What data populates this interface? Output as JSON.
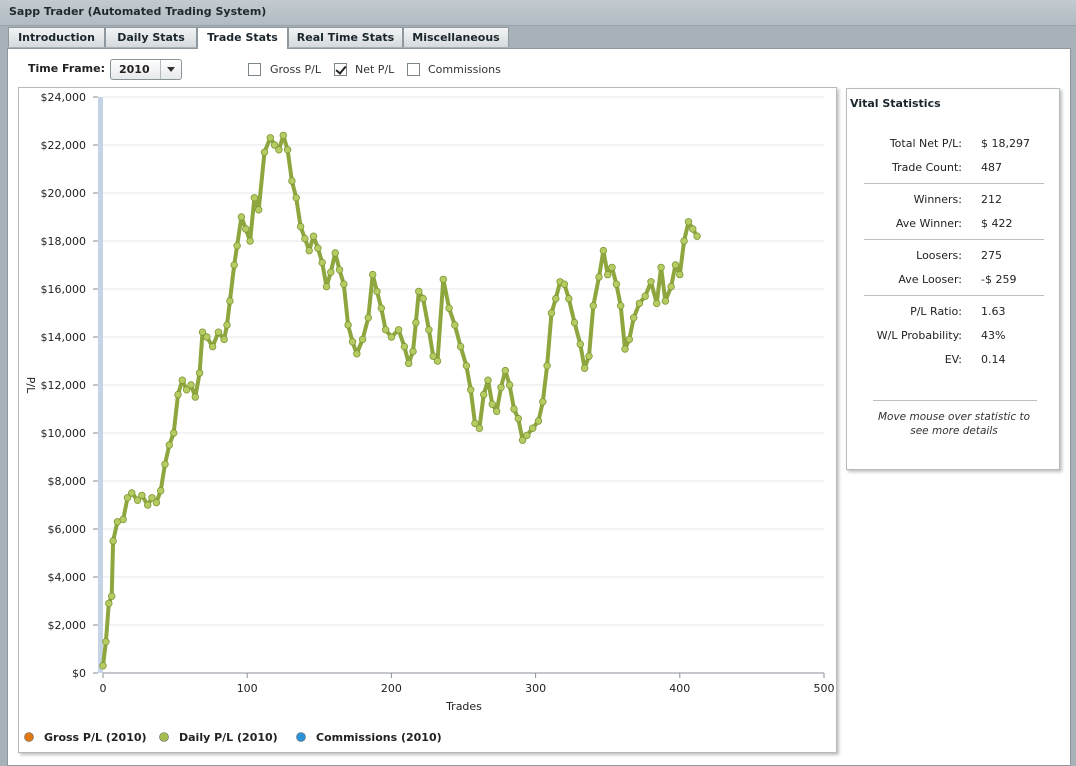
{
  "window": {
    "title": "Sapp Trader (Automated Trading System)"
  },
  "tabs": [
    {
      "label": "Introduction"
    },
    {
      "label": "Daily Stats"
    },
    {
      "label": "Trade Stats",
      "active": true
    },
    {
      "label": "Real Time Stats"
    },
    {
      "label": "Miscellaneous"
    }
  ],
  "controls": {
    "time_frame_label": "Time Frame:",
    "time_frame_value": "2010",
    "checkboxes": [
      {
        "label": "Gross P/L",
        "checked": false
      },
      {
        "label": "Net P/L",
        "checked": true
      },
      {
        "label": "Commissions",
        "checked": false
      }
    ]
  },
  "stats": {
    "title": "Vital Statistics",
    "rows": [
      {
        "label": "Total Net P/L:",
        "value": "$ 18,297"
      },
      {
        "label": "Trade Count:",
        "value": "487"
      },
      {
        "label": "Winners:",
        "value": "212"
      },
      {
        "label": "Ave Winner:",
        "value": "$ 422"
      },
      {
        "label": "Loosers:",
        "value": "275"
      },
      {
        "label": "Ave Looser:",
        "value": "-$ 259"
      },
      {
        "label": "P/L Ratio:",
        "value": "1.63"
      },
      {
        "label": "W/L Probability:",
        "value": "43%"
      },
      {
        "label": "EV:",
        "value": "0.14"
      }
    ],
    "hint_line1": "Move mouse over statistic to",
    "hint_line2": "see more details"
  },
  "chart_data": {
    "type": "line",
    "xlabel": "Trades",
    "ylabel": "P/L",
    "xlim": [
      0,
      500
    ],
    "ylim": [
      0,
      24000
    ],
    "x_ticks": [
      "0",
      "100",
      "200",
      "300",
      "400",
      "500"
    ],
    "y_ticks": [
      "$0",
      "$2,000",
      "$4,000",
      "$6,000",
      "$8,000",
      "$10,000",
      "$12,000",
      "$14,000",
      "$16,000",
      "$18,000",
      "$20,000",
      "$22,000",
      "$24,000"
    ],
    "grid": "horizontal",
    "legend_position": "bottom-left",
    "legend": [
      {
        "name": "Gross P/L (2010)",
        "color": "#e07a10"
      },
      {
        "name": "Daily P/L (2010)",
        "color": "#a6bd52"
      },
      {
        "name": "Commissions (2010)",
        "color": "#2b93d6"
      }
    ],
    "series": [
      {
        "name": "Daily P/L (2010)",
        "color": "#8ea63e",
        "marker_color": "#b5cc62",
        "points": [
          [
            0,
            300
          ],
          [
            2,
            1300
          ],
          [
            4,
            2900
          ],
          [
            6,
            3200
          ],
          [
            7,
            5500
          ],
          [
            10,
            6300
          ],
          [
            14,
            6400
          ],
          [
            17,
            7300
          ],
          [
            20,
            7500
          ],
          [
            24,
            7200
          ],
          [
            27,
            7400
          ],
          [
            31,
            7000
          ],
          [
            34,
            7300
          ],
          [
            37,
            7100
          ],
          [
            40,
            7600
          ],
          [
            43,
            8700
          ],
          [
            46,
            9500
          ],
          [
            49,
            10000
          ],
          [
            52,
            11600
          ],
          [
            55,
            12200
          ],
          [
            58,
            11800
          ],
          [
            61,
            12000
          ],
          [
            64,
            11500
          ],
          [
            67,
            12500
          ],
          [
            69,
            14200
          ],
          [
            72,
            14000
          ],
          [
            76,
            13600
          ],
          [
            80,
            14200
          ],
          [
            84,
            13900
          ],
          [
            86,
            14500
          ],
          [
            88,
            15500
          ],
          [
            91,
            17000
          ],
          [
            93,
            17800
          ],
          [
            96,
            19000
          ],
          [
            99,
            18500
          ],
          [
            102,
            18000
          ],
          [
            105,
            19800
          ],
          [
            108,
            19300
          ],
          [
            112,
            21700
          ],
          [
            116,
            22300
          ],
          [
            119,
            22000
          ],
          [
            122,
            21800
          ],
          [
            125,
            22400
          ],
          [
            128,
            21800
          ],
          [
            131,
            20500
          ],
          [
            134,
            19800
          ],
          [
            137,
            18600
          ],
          [
            140,
            18100
          ],
          [
            143,
            17600
          ],
          [
            146,
            18200
          ],
          [
            149,
            17700
          ],
          [
            152,
            17100
          ],
          [
            155,
            16100
          ],
          [
            158,
            16700
          ],
          [
            161,
            17500
          ],
          [
            164,
            16800
          ],
          [
            167,
            16200
          ],
          [
            170,
            14500
          ],
          [
            173,
            13800
          ],
          [
            176,
            13300
          ],
          [
            180,
            13900
          ],
          [
            184,
            14800
          ],
          [
            187,
            16600
          ],
          [
            190,
            15900
          ],
          [
            193,
            15200
          ],
          [
            196,
            14300
          ],
          [
            200,
            14000
          ],
          [
            205,
            14300
          ],
          [
            209,
            13600
          ],
          [
            212,
            12900
          ],
          [
            215,
            13400
          ],
          [
            217,
            14600
          ],
          [
            219,
            15900
          ],
          [
            222,
            15600
          ],
          [
            226,
            14300
          ],
          [
            229,
            13200
          ],
          [
            232,
            13000
          ],
          [
            236,
            16400
          ],
          [
            240,
            15200
          ],
          [
            244,
            14500
          ],
          [
            248,
            13600
          ],
          [
            252,
            12800
          ],
          [
            255,
            11800
          ],
          [
            258,
            10400
          ],
          [
            261,
            10200
          ],
          [
            264,
            11600
          ],
          [
            267,
            12200
          ],
          [
            270,
            11200
          ],
          [
            273,
            10900
          ],
          [
            276,
            11900
          ],
          [
            279,
            12600
          ],
          [
            282,
            12000
          ],
          [
            285,
            11000
          ],
          [
            288,
            10600
          ],
          [
            291,
            9700
          ],
          [
            294,
            9900
          ],
          [
            298,
            10200
          ],
          [
            302,
            10500
          ],
          [
            305,
            11300
          ],
          [
            308,
            12800
          ],
          [
            311,
            15000
          ],
          [
            314,
            15600
          ],
          [
            317,
            16300
          ],
          [
            320,
            16200
          ],
          [
            323,
            15600
          ],
          [
            327,
            14600
          ],
          [
            331,
            13700
          ],
          [
            334,
            12700
          ],
          [
            337,
            13200
          ],
          [
            340,
            15300
          ],
          [
            344,
            16500
          ],
          [
            347,
            17600
          ],
          [
            350,
            16600
          ],
          [
            353,
            16900
          ],
          [
            356,
            16200
          ],
          [
            359,
            15300
          ],
          [
            362,
            13500
          ],
          [
            365,
            13900
          ],
          [
            368,
            14800
          ],
          [
            372,
            15400
          ],
          [
            376,
            15700
          ],
          [
            380,
            16300
          ],
          [
            384,
            15400
          ],
          [
            387,
            16900
          ],
          [
            390,
            15500
          ],
          [
            394,
            16100
          ],
          [
            397,
            17000
          ],
          [
            400,
            16600
          ],
          [
            403,
            18000
          ],
          [
            406,
            18800
          ],
          [
            409,
            18500
          ],
          [
            412,
            18200
          ]
        ]
      }
    ]
  }
}
